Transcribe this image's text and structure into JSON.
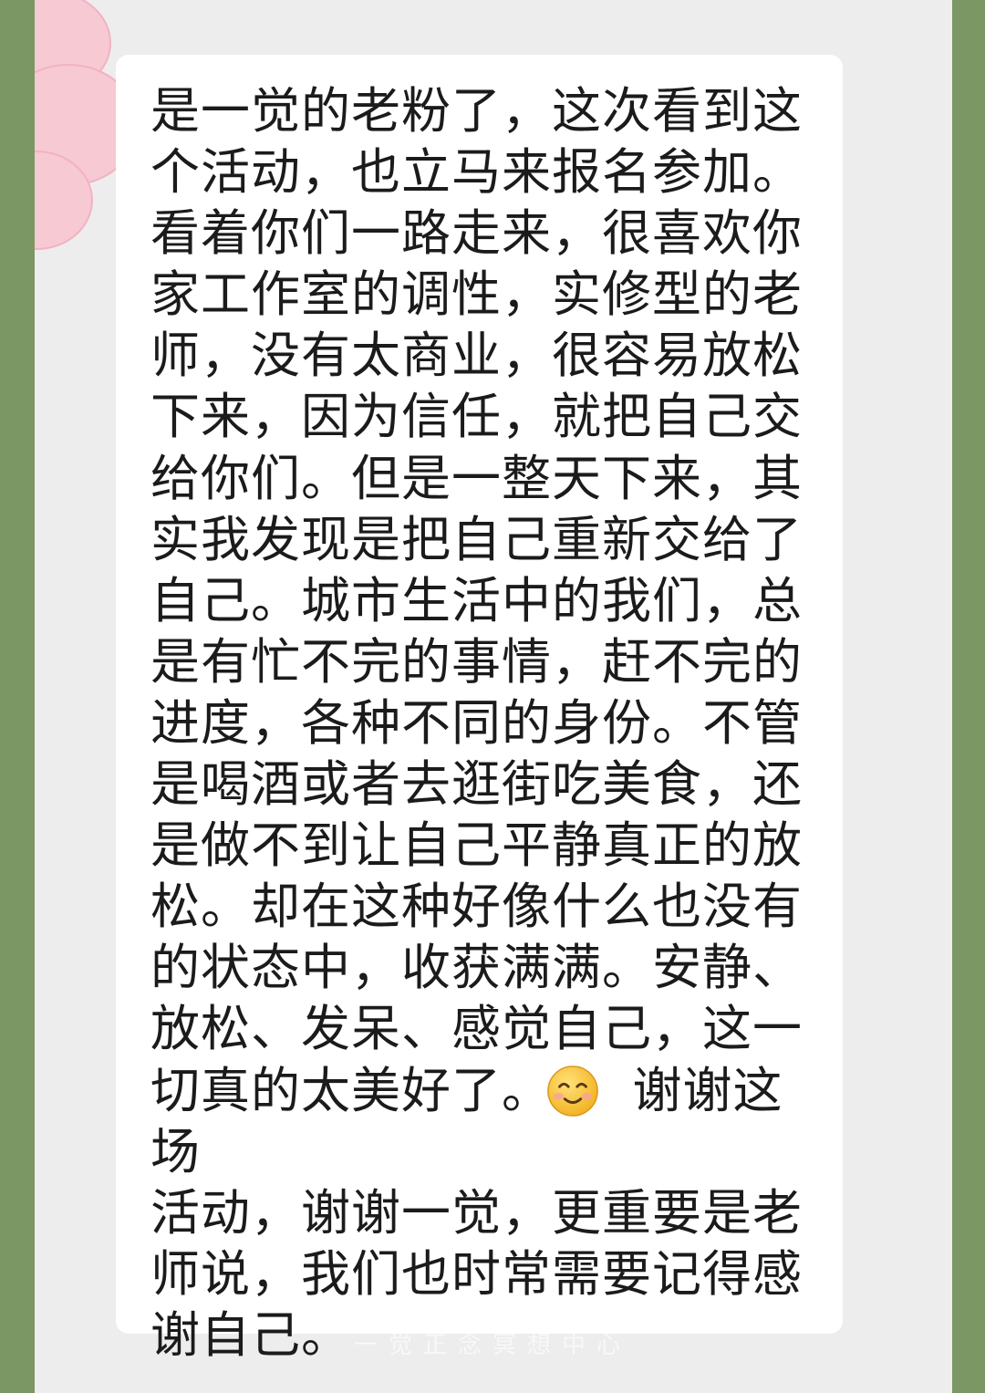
{
  "message": {
    "lines": [
      "是一觉的老粉了，这次看到这",
      "个活动，也立马来报名参加。",
      "看着你们一路走来，很喜欢你",
      "家工作室的调性，实修型的老",
      "师，没有太商业，很容易放松",
      "下来，因为信任，就把自己交",
      "给你们。但是一整天下来，其",
      "实我发现是把自己重新交给了",
      "自己。城市生活中的我们，总",
      "是有忙不完的事情，赶不完的",
      "进度，各种不同的身份。不管",
      "是喝酒或者去逛街吃美食，还",
      "是做不到让自己平静真正的放",
      "松。却在这种好像什么也没有",
      "的状态中，收获满满。安静、",
      "放松、发呆、感觉自己，这一",
      "切真的太美好了。 　谢谢这场",
      "活动，谢谢一觉，更重要是老",
      "师说，我们也时常需要记得感",
      "谢自己。"
    ],
    "emoji": "smile-icon"
  },
  "watermark": "一觉正念冥想中心",
  "colors": {
    "frame_green": "#7a9764",
    "screen_bg": "#ededed",
    "bubble_bg": "#ffffff",
    "text": "#1b1b1b",
    "flower_pink": "#f7c9d3"
  }
}
